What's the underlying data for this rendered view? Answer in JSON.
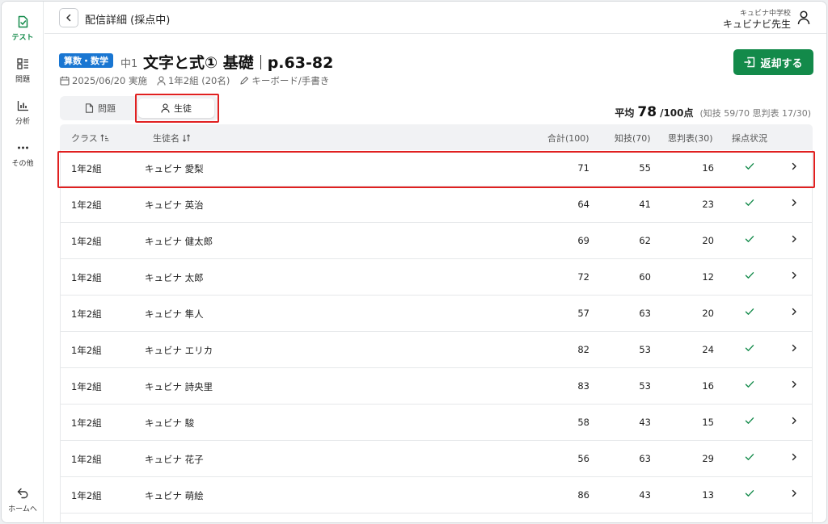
{
  "sidebar": {
    "items": [
      {
        "label": "テスト",
        "icon": "test-icon",
        "active": true
      },
      {
        "label": "問題",
        "icon": "problems-icon"
      },
      {
        "label": "分析",
        "icon": "analysis-icon"
      },
      {
        "label": "その他",
        "icon": "more-icon"
      }
    ],
    "home_label": "ホームへ"
  },
  "header": {
    "title": "配信詳細 (採点中)",
    "school": "キュビナ中学校",
    "teacher": "キュビナビ先生"
  },
  "test": {
    "subject": "算数・数学",
    "grade": "中1",
    "title": "文字と式① 基礎",
    "pages": "p.63-82",
    "date": "2025/06/20 実施",
    "class_info": "1年2組 (20名)",
    "input_method": "キーボード/手書き",
    "return_label": "返却する"
  },
  "tabs": {
    "problems": "問題",
    "students": "生徒"
  },
  "average": {
    "label": "平均",
    "value": "78",
    "unit": "/100点",
    "detail": "(知技 59/70  思判表 17/30)"
  },
  "table": {
    "headers": {
      "class": "クラス",
      "name": "生徒名",
      "total": "合計(100)",
      "knowledge": "知技(70)",
      "thinking": "思判表(30)",
      "status": "採点状況"
    },
    "rows": [
      {
        "class": "1年2組",
        "name": "キュビナ 愛梨",
        "total": "71",
        "knowledge": "55",
        "thinking": "16"
      },
      {
        "class": "1年2組",
        "name": "キュビナ 英治",
        "total": "64",
        "knowledge": "41",
        "thinking": "23"
      },
      {
        "class": "1年2組",
        "name": "キュビナ 健太郎",
        "total": "69",
        "knowledge": "62",
        "thinking": "20"
      },
      {
        "class": "1年2組",
        "name": "キュビナ 太郎",
        "total": "72",
        "knowledge": "60",
        "thinking": "12"
      },
      {
        "class": "1年2組",
        "name": "キュビナ 隼人",
        "total": "57",
        "knowledge": "63",
        "thinking": "20"
      },
      {
        "class": "1年2組",
        "name": "キュビナ エリカ",
        "total": "82",
        "knowledge": "53",
        "thinking": "24"
      },
      {
        "class": "1年2組",
        "name": "キュビナ 詩央里",
        "total": "83",
        "knowledge": "53",
        "thinking": "16"
      },
      {
        "class": "1年2組",
        "name": "キュビナ 駿",
        "total": "58",
        "knowledge": "43",
        "thinking": "15"
      },
      {
        "class": "1年2組",
        "name": "キュビナ 花子",
        "total": "56",
        "knowledge": "63",
        "thinking": "29"
      },
      {
        "class": "1年2組",
        "name": "キュビナ 萌絵",
        "total": "86",
        "knowledge": "43",
        "thinking": "13"
      }
    ]
  },
  "colors": {
    "accent_green": "#138a4a",
    "badge_blue": "#1976d2",
    "highlight_red": "#e02020"
  }
}
